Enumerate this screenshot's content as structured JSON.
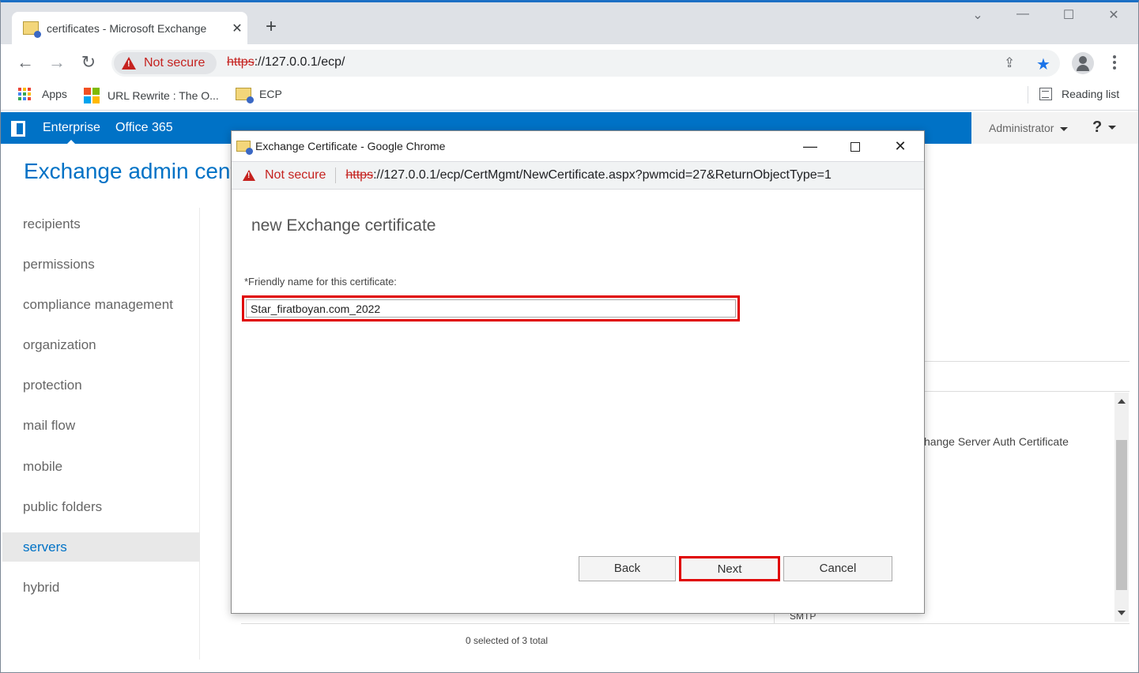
{
  "browser": {
    "tab": {
      "title": "certificates - Microsoft Exchange"
    },
    "new_tab_symbol": "+",
    "address": {
      "security_label": "Not secure",
      "url_scheme": "https",
      "url_rest": "://127.0.0.1/ecp/"
    },
    "bookmarks": [
      {
        "label": "Apps",
        "icon": "apps-grid-icon"
      },
      {
        "label": "URL Rewrite : The O...",
        "icon": "microsoft-logo-icon"
      },
      {
        "label": "ECP",
        "icon": "exchange-mail-icon"
      }
    ],
    "reading_list_label": "Reading list"
  },
  "ecp": {
    "header_links": [
      "Enterprise",
      "Office 365"
    ],
    "user_menu": "Administrator",
    "help_label": "?",
    "title": "Exchange admin center",
    "nav": [
      {
        "label": "recipients",
        "selected": false
      },
      {
        "label": "permissions",
        "selected": false
      },
      {
        "label": "compliance management",
        "selected": false
      },
      {
        "label": "organization",
        "selected": false
      },
      {
        "label": "protection",
        "selected": false
      },
      {
        "label": "mail flow",
        "selected": false
      },
      {
        "label": "mobile",
        "selected": false
      },
      {
        "label": "public folders",
        "selected": false
      },
      {
        "label": "servers",
        "selected": true
      },
      {
        "label": "hybrid",
        "selected": false
      }
    ],
    "background_list": {
      "partial_cert_name": "hange Server Auth Certificate",
      "partial_service": "SMTP"
    },
    "status_text": "0 selected of 3 total"
  },
  "popup": {
    "window_title": "Exchange Certificate - Google Chrome",
    "security_label": "Not secure",
    "url_scheme": "https",
    "url_rest": "://127.0.0.1/ecp/CertMgmt/NewCertificate.aspx?pwmcid=27&ReturnObjectType=1",
    "heading": "new Exchange certificate",
    "friendly_name_label": "*Friendly name for this certificate:",
    "friendly_name_value": "Star_firatboyan.com_2022",
    "buttons": {
      "back": "Back",
      "next": "Next",
      "cancel": "Cancel"
    }
  },
  "colors": {
    "ecp_blue": "#0072c6",
    "warning_red": "#c5221f",
    "highlight_red": "#e00000"
  }
}
